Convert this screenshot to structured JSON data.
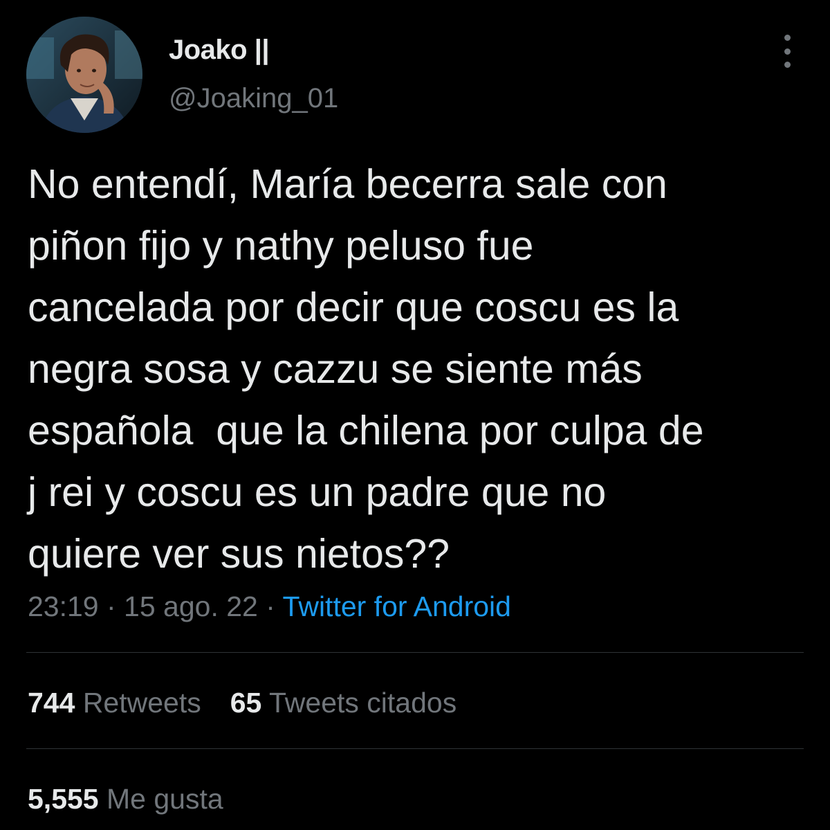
{
  "author": {
    "display_name": "Joako ||",
    "handle": "@Joaking_01"
  },
  "tweet": {
    "lines": [
      "No entendí, María becerra sale con",
      "piñon fijo y nathy peluso fue",
      "cancelada por decir que coscu es la",
      "negra sosa y cazzu se siente más",
      "española  que la chilena por culpa de",
      "j rei y coscu es un padre que no",
      "quiere ver sus nietos??"
    ]
  },
  "meta": {
    "time": "23:19",
    "separator": " · ",
    "date": "15 ago. 22",
    "source": "Twitter for Android"
  },
  "stats": {
    "retweets_count": "744",
    "retweets_label": "Retweets",
    "quotes_count": "65",
    "quotes_label": "Tweets citados",
    "likes_count": "5,555",
    "likes_label": "Me gusta"
  },
  "icons": {
    "more": "more-vertical-icon"
  },
  "colors": {
    "background": "#000000",
    "text_primary": "#e7e9ea",
    "text_secondary": "#71767b",
    "link": "#1d9bf0",
    "divider": "#2f3336"
  }
}
